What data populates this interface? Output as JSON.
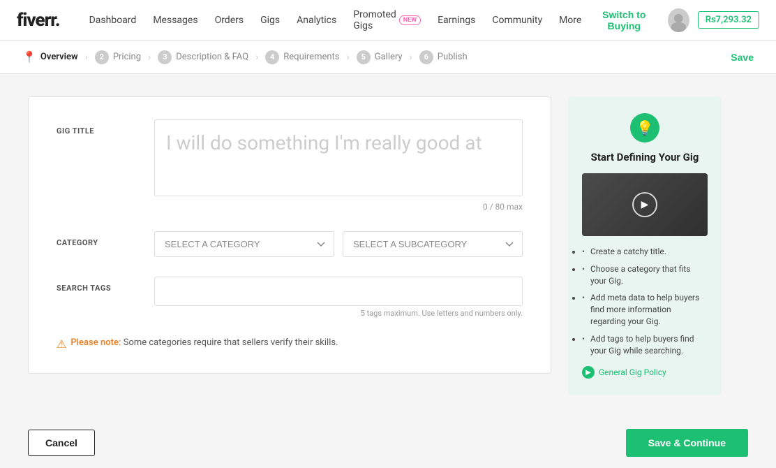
{
  "nav": {
    "logo": "fiverr.",
    "logo_dot": ".",
    "links": [
      {
        "label": "Dashboard",
        "id": "dashboard"
      },
      {
        "label": "Messages",
        "id": "messages"
      },
      {
        "label": "Orders",
        "id": "orders"
      },
      {
        "label": "Gigs",
        "id": "gigs"
      },
      {
        "label": "Analytics",
        "id": "analytics"
      },
      {
        "label": "Promoted Gigs",
        "id": "promoted-gigs"
      },
      {
        "label": "Earnings",
        "id": "earnings"
      },
      {
        "label": "Community",
        "id": "community"
      },
      {
        "label": "More",
        "id": "more"
      }
    ],
    "promoted_new_badge": "NEW",
    "switch_buying": "Switch to Buying",
    "balance": "Rs7,293.32"
  },
  "breadcrumb": {
    "steps": [
      {
        "num": "1",
        "label": "Overview",
        "active": true,
        "icon": true
      },
      {
        "num": "2",
        "label": "Pricing",
        "active": false
      },
      {
        "num": "3",
        "label": "Description & FAQ",
        "active": false
      },
      {
        "num": "4",
        "label": "Requirements",
        "active": false
      },
      {
        "num": "5",
        "label": "Gallery",
        "active": false
      },
      {
        "num": "6",
        "label": "Publish",
        "active": false
      }
    ],
    "save_label": "Save"
  },
  "form": {
    "gig_title_label": "GIG TITLE",
    "gig_title_placeholder": "I will do something I'm really good at",
    "char_count": "0 / 80 max",
    "category_label": "CATEGORY",
    "select_category": "SELECT A CATEGORY",
    "select_subcategory": "SELECT A SUBCATEGORY",
    "search_tags_label": "SEARCH TAGS",
    "tags_hint": "5 tags maximum. Use letters and numbers only.",
    "note_text": "Some categories require that sellers verify their skills.",
    "note_label": "Please note:"
  },
  "sidebar": {
    "title": "Start Defining Your Gig",
    "tips": [
      "Create a catchy title.",
      "Choose a category that fits your Gig.",
      "Add meta data to help buyers find more information regarding your Gig.",
      "Add tags to help buyers find your Gig while searching."
    ],
    "policy_label": "General Gig Policy"
  },
  "actions": {
    "cancel": "Cancel",
    "save_continue": "Save & Continue"
  }
}
